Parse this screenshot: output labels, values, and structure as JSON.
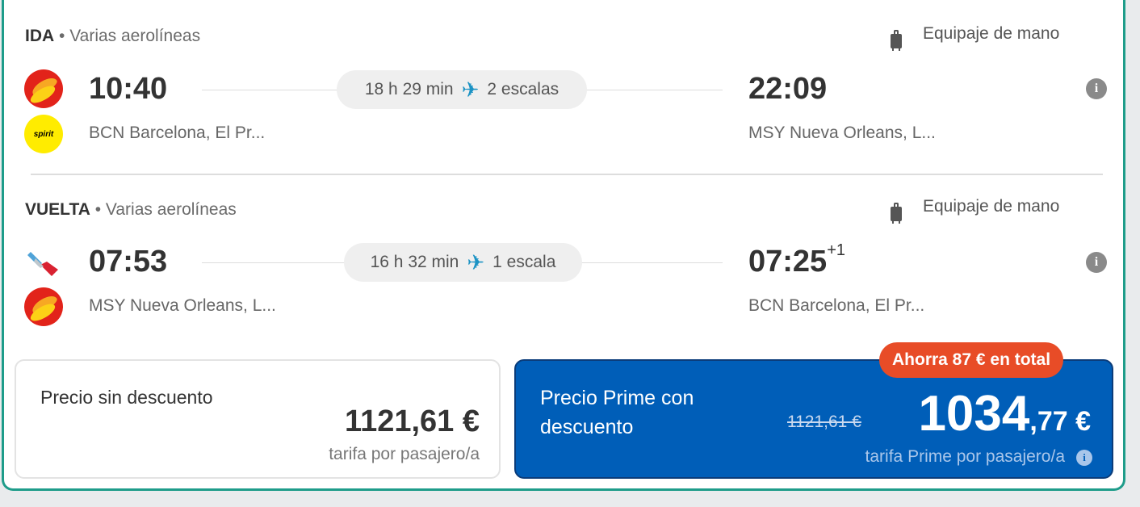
{
  "outbound": {
    "direction": "IDA",
    "airlines_label": "Varias aerolíneas",
    "baggage": "Equipaje de mano",
    "departure_time": "10:40",
    "duration": "18 h 29 min",
    "stops": "2 escalas",
    "arrival_time": "22:09",
    "origin": "BCN Barcelona, El Pr...",
    "destination": "MSY Nueva Orleans, L...",
    "logos": [
      "iberia",
      "spirit"
    ],
    "spirit_text": "spirit"
  },
  "return": {
    "direction": "VUELTA",
    "airlines_label": "Varias aerolíneas",
    "baggage": "Equipaje de mano",
    "departure_time": "07:53",
    "duration": "16 h 32 min",
    "stops": "1 escala",
    "arrival_time": "07:25",
    "arrival_day_offset": "+1",
    "origin": "MSY Nueva Orleans, L...",
    "destination": "BCN Barcelona, El Pr...",
    "logos": [
      "american-airlines",
      "iberia"
    ]
  },
  "price_regular": {
    "label": "Precio sin descuento",
    "amount": "1121,61 €",
    "note": "tarifa por pasajero/a"
  },
  "price_prime": {
    "label_line1": "Precio Prime con",
    "label_line2": "descuento",
    "old_amount": "1121,61 €",
    "amount_int": "1034",
    "amount_dec": ",77 €",
    "note": "tarifa Prime por pasajero/a",
    "savings_badge": "Ahorra 87 € en total",
    "color": "#005eb8"
  },
  "icons": {
    "info": "i",
    "plane": "✈"
  },
  "colors": {
    "border": "#1e9c8a",
    "plane": "#1c93c4",
    "badge": "#e84c27"
  }
}
